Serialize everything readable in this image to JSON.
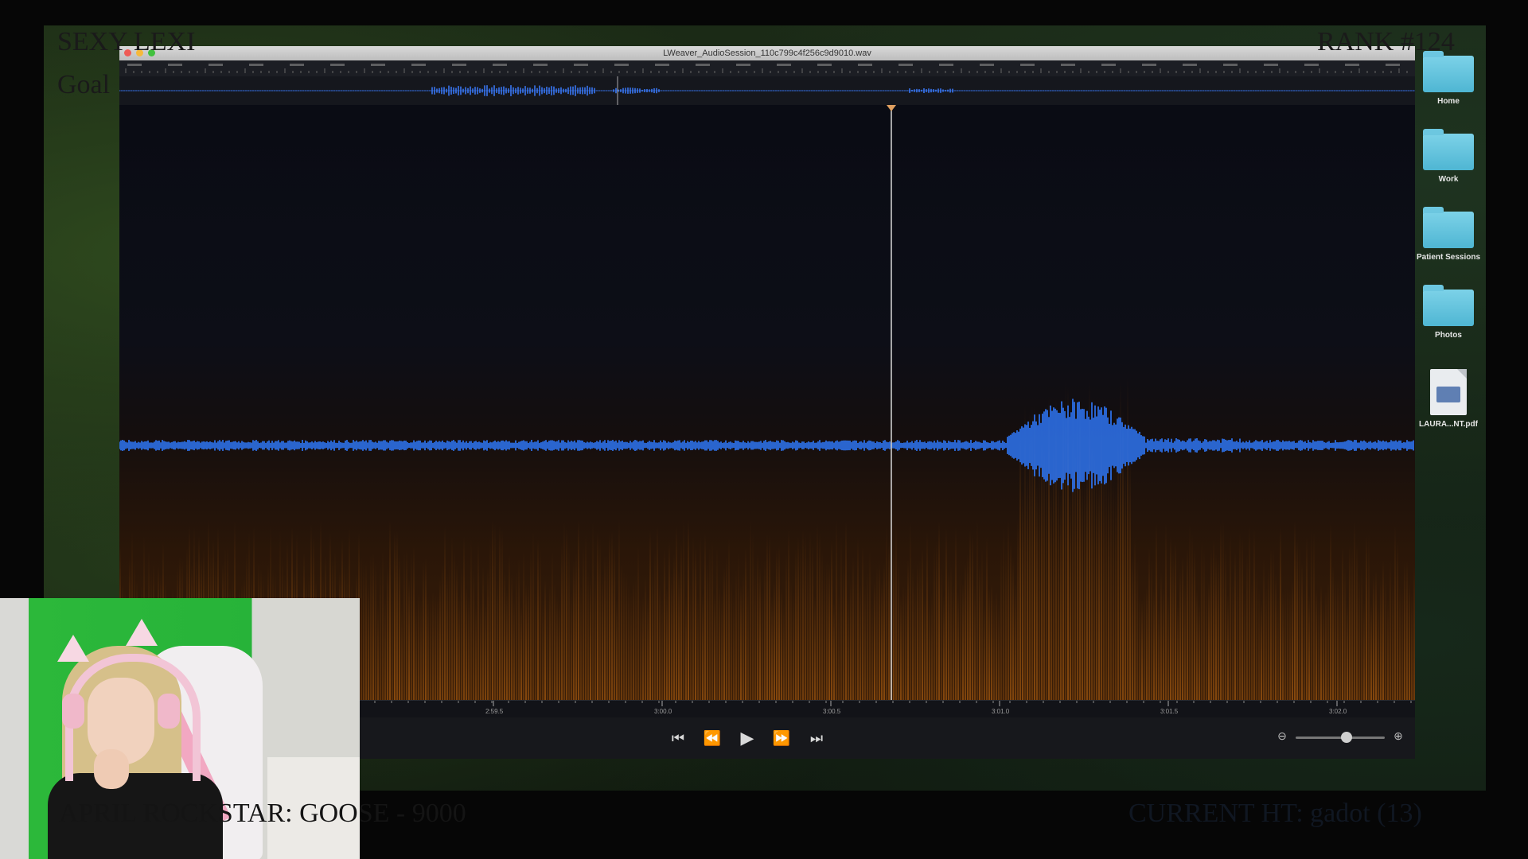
{
  "overlay": {
    "top_left_title": "SEXY LEXI",
    "top_left_sub": "Goal",
    "top_right": "RANK #124",
    "bottom_left": "APRIL ROCKSTAR: GOOSE - 9000",
    "bottom_right": "CURRENT HT: gadot (13)"
  },
  "window": {
    "title": "LWeaver_AudioSession_110c799c4f256c9d9010.wav"
  },
  "ruler": {
    "labels": [
      "2:59.5",
      "3:00.0",
      "3:00.5",
      "3:01.0",
      "3:01.5",
      "3:02.0"
    ]
  },
  "transport": {
    "skip_back": "⏮",
    "rewind": "⏪",
    "play": "▶",
    "fast_forward": "⏩",
    "skip_forward": "⏭",
    "zoom_out": "⊖",
    "zoom_in": "⊕"
  },
  "zoom_level": 0.5,
  "desktop": {
    "items": [
      {
        "label": "Home",
        "icon": "folder-icon"
      },
      {
        "label": "Work",
        "icon": "folder-icon"
      },
      {
        "label": "Patient Sessions",
        "icon": "folder-icon"
      },
      {
        "label": "Photos",
        "icon": "folder-icon"
      },
      {
        "label": "LAURA...NT.pdf",
        "icon": "pdf-file-icon"
      }
    ]
  },
  "colors": {
    "waveform": "#2f7bff",
    "spectrogram": "#c86d12",
    "playhead": "#d8d8d8",
    "folder": "#5bbfd9",
    "greenscreen": "#2ab53a"
  }
}
